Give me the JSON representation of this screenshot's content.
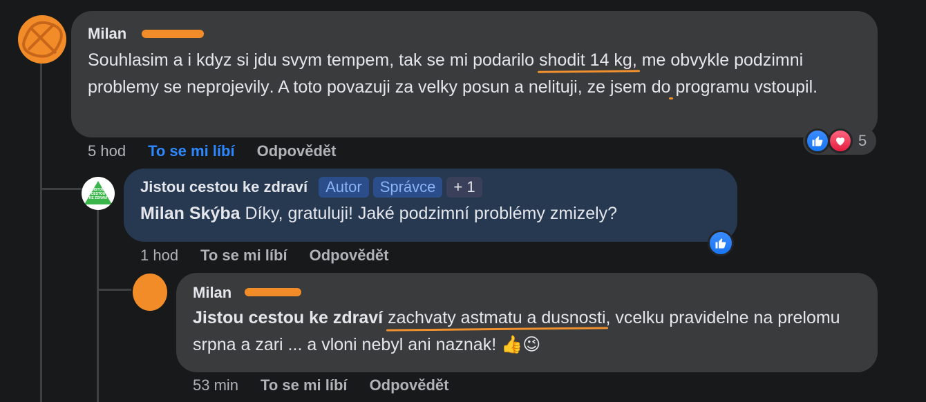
{
  "comments": [
    {
      "author": "Milan",
      "segments": [
        {
          "t": "Souhlasim a i kdyz si jdu svym tempem, tak se mi podarilo "
        },
        {
          "t": "shodit 14 kg,",
          "hl": true
        },
        {
          "t": " me "
        },
        {
          "t": "obvykle podzimni problemy se neprojevily",
          "hl": true
        },
        {
          "t": ". A toto povazuji za velky posun a nelituji, ze jsem do programu vstoupil."
        }
      ],
      "time": "5 hod",
      "like_label": "To se mi líbí",
      "reply_label": "Odpovědět",
      "reaction_count": "5"
    },
    {
      "author": "Jistou cestou ke zdraví",
      "badges": [
        "Autor",
        "Správce",
        "+ 1"
      ],
      "mention": "Milan Skýba",
      "text": " Díky, gratuluji! Jaké podzimní problémy zmizely?",
      "time": "1 hod",
      "like_label": "To se mi líbí",
      "reply_label": "Odpovědět",
      "logo_lines": [
        "JISTOU",
        "CESTOU",
        "KE ZDRAVÍ"
      ]
    },
    {
      "author": "Milan",
      "mention": "Jistou cestou ke zdraví",
      "segments": [
        {
          "t": " "
        },
        {
          "t": "zachvaty astmatu a dusnosti",
          "hl": true
        },
        {
          "t": ", vcelku pravidelne na prelomu srpna a zari ... a vloni nebyl ani naznak! 👍😉"
        }
      ],
      "time": "53 min",
      "like_label": "To se mi líbí",
      "reply_label": "Odpovědět"
    }
  ],
  "colors": {
    "like": "#2d88ff",
    "bubble": "#3a3b3c",
    "page_bubble": "#263951",
    "scribble": "#f28c28"
  }
}
